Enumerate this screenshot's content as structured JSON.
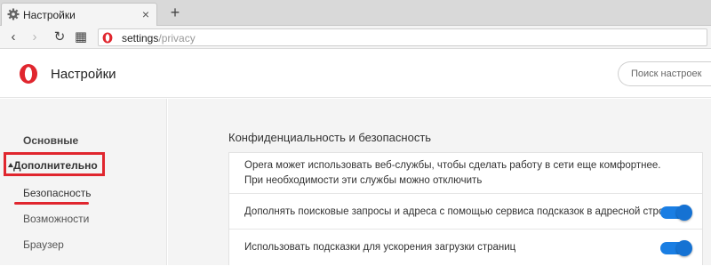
{
  "tab": {
    "title": "Настройки",
    "close_glyph": "×",
    "new_tab_glyph": "+"
  },
  "toolbar": {
    "back_glyph": "‹",
    "forward_glyph": "›",
    "reload_glyph": "↻",
    "grid_glyph": "▦",
    "url_host": "settings",
    "url_path": "/privacy"
  },
  "header": {
    "title": "Настройки",
    "search_placeholder": "Поиск настроек"
  },
  "sidebar": {
    "items": [
      {
        "label": "Основные"
      },
      {
        "label": "Дополнительно"
      },
      {
        "label": "Безопасность"
      },
      {
        "label": "Возможности"
      },
      {
        "label": "Браузер"
      }
    ]
  },
  "main": {
    "section_title": "Конфиденциальность и безопасность",
    "rows": [
      {
        "text": "Opera может использовать веб-службы, чтобы сделать работу в сети еще комфортнее. При необходимости эти службы можно отключить"
      },
      {
        "text": "Дополнять поисковые запросы и адреса с помощью сервиса подсказок в адресной строке",
        "enabled": true
      },
      {
        "text": "Использовать подсказки для ускорения загрузки страниц",
        "enabled": true
      }
    ]
  },
  "colors": {
    "accent": "#e0262e",
    "toggle": "#1a7ee3",
    "opera_red": "#e0262e"
  },
  "icons": {
    "tab": "gear-icon",
    "brand": "opera-logo-icon"
  }
}
